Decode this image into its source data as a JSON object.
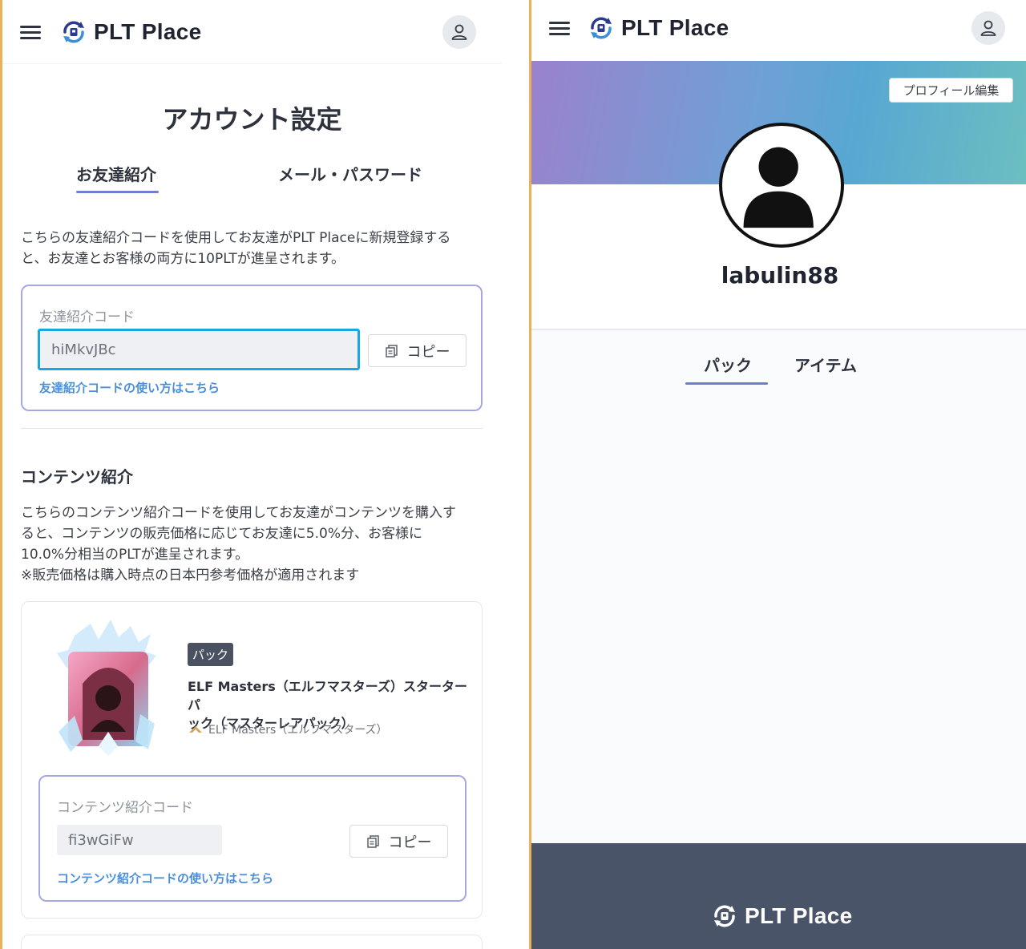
{
  "app": {
    "name": "PLT Place"
  },
  "left": {
    "page_title": "アカウント設定",
    "tabs": [
      {
        "label": "お友達紹介",
        "active": true
      },
      {
        "label": "メール・パスワード",
        "active": false
      }
    ],
    "referral": {
      "description_line1": "こちらの友達紹介コードを使用してお友達がPLT Placeに新規登録する",
      "description_line2": "と、お友達とお客様の両方に10PLTが進呈されます。",
      "card_label": "友達紹介コード",
      "code": "hiMkvJBc",
      "copy_label": "コピー",
      "help_link": "友達紹介コードの使い方はこちら"
    },
    "content_referral": {
      "section_title": "コンテンツ紹介",
      "description_line1": "こちらのコンテンツ紹介コードを使用してお友達がコンテンツを購入す",
      "description_line2": "ると、コンテンツの販売価格に応じてお友達に5.0%分、お客様に",
      "description_line3": "10.0%分相当のPLTが進呈されます。",
      "note": "※販売価格は購入時点の日本円参考価格が適用されます",
      "product": {
        "badge": "パック",
        "title_line1": "ELF Masters（エルフマスターズ）スターターパ",
        "title_line2": "ック（マスターレアパック）",
        "source": "ELF Masters（エルフマスターズ）"
      },
      "card_label": "コンテンツ紹介コード",
      "code": "fi3wGiFw",
      "copy_label": "コピー",
      "help_link": "コンテンツ紹介コードの使い方はこちら"
    }
  },
  "right": {
    "edit_profile_label": "プロフィール編集",
    "username": "labulin88",
    "tabs": [
      {
        "label": "パック",
        "active": true
      },
      {
        "label": "アイテム",
        "active": false
      }
    ]
  },
  "colors": {
    "accent": "#6e7fd0",
    "link": "#4a8fd8",
    "highlight_border": "#1aa7e0",
    "footer_bg": "#4a5468",
    "side_border": "#e7b25a"
  },
  "icons": {
    "menu": "hamburger-icon",
    "logo": "plt-logo-icon",
    "user": "user-icon",
    "copy": "copy-icon",
    "avatar": "default-avatar-icon"
  }
}
